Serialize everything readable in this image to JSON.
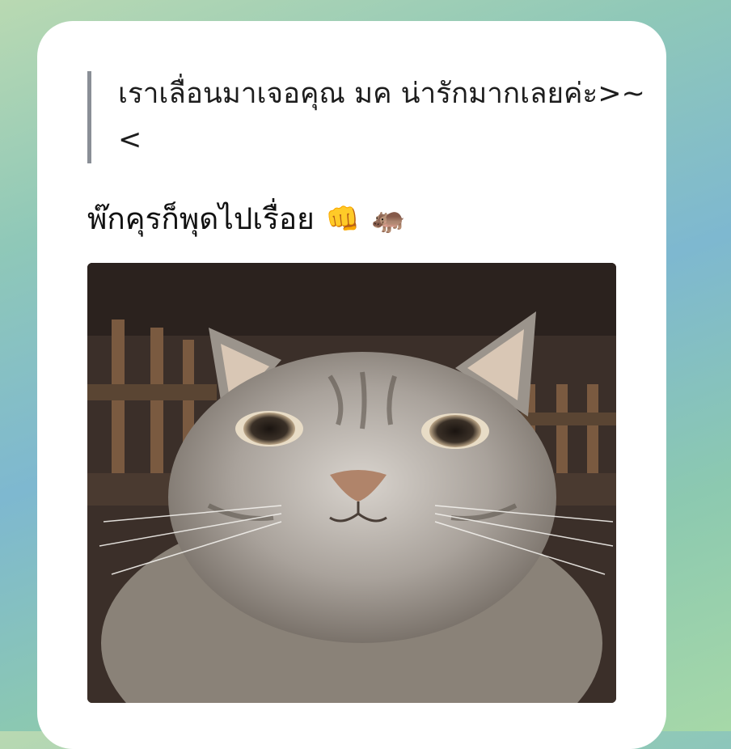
{
  "reply_quote": {
    "text": "เราเลื่อนมาเจอคุณ มค น่ารักมากเลยค่ะ>~<"
  },
  "message": {
    "text": "พ๊กคุรก็พุดไปเรื่อย",
    "emoji": [
      "👊",
      "🦛"
    ]
  },
  "attachment": {
    "icon": "cat-photo",
    "alt": ""
  },
  "colors": {
    "bubble": "#ffffff",
    "quote_bar": "#8a8f96",
    "text": "#111111"
  }
}
